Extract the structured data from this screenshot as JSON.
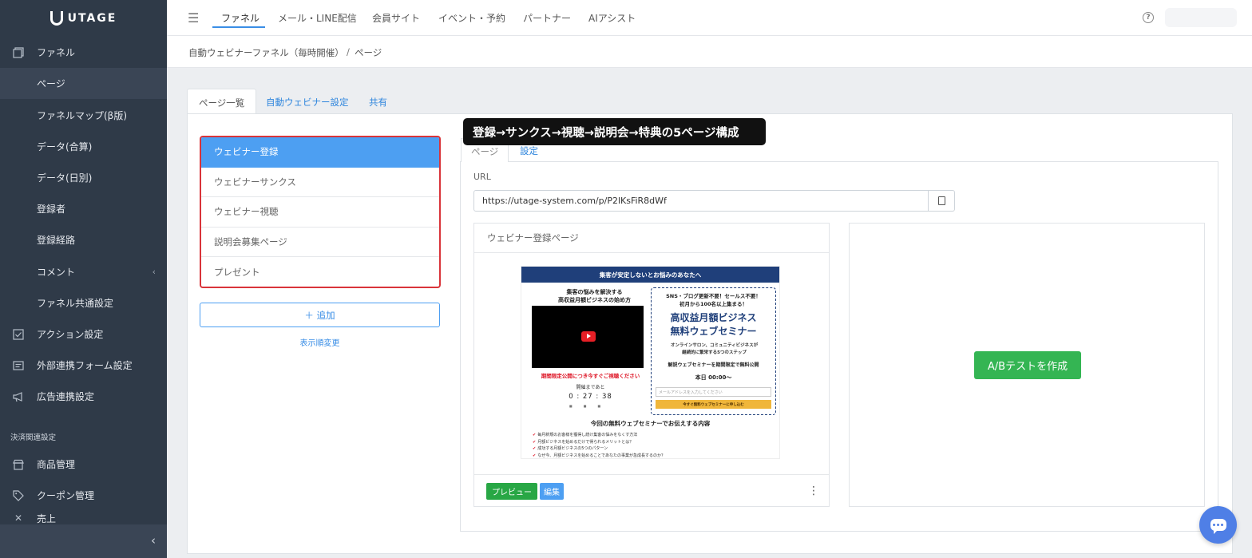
{
  "brand": {
    "name": "UTAGE"
  },
  "sidebar": {
    "items": [
      {
        "label": "ファネル",
        "icon": "funnel-icon"
      },
      {
        "label": "ページ"
      },
      {
        "label": "ファネルマップ(β版)"
      },
      {
        "label": "データ(合算)"
      },
      {
        "label": "データ(日別)"
      },
      {
        "label": "登録者"
      },
      {
        "label": "登録経路"
      },
      {
        "label": "コメント"
      },
      {
        "label": "ファネル共通設定"
      },
      {
        "label": "アクション設定",
        "icon": "checklist-icon"
      },
      {
        "label": "外部連携フォーム設定",
        "icon": "form-icon"
      },
      {
        "label": "広告連携設定",
        "icon": "megaphone-icon"
      },
      {
        "label": "商品管理",
        "icon": "store-icon"
      },
      {
        "label": "クーポン管理",
        "icon": "tag-icon"
      },
      {
        "label": "売上"
      }
    ],
    "section_label": "決済関連設定"
  },
  "topnav": {
    "items": [
      "ファネル",
      "メール・LINE配信",
      "会員サイト",
      "イベント・予約",
      "パートナー",
      "AIアシスト"
    ]
  },
  "breadcrumb": {
    "funnel": "自動ウェビナーファネル（毎時開催）",
    "separator": "/",
    "current": "ページ"
  },
  "tabs": [
    "ページ一覧",
    "自動ウェビナー設定",
    "共有"
  ],
  "pages": [
    "ウェビナー登録",
    "ウェビナーサンクス",
    "ウェビナー視聴",
    "説明会募集ページ",
    "プレゼント"
  ],
  "add_label": "＋ 追加",
  "reorder_label": "表示順変更",
  "annotation": "登録→サンクス→視聴→説明会→特典の5ページ構成",
  "detail": {
    "tabs": [
      "ページ",
      "設定"
    ],
    "url_label": "URL",
    "url_value": "https://utage-system.com/p/P2lKsFiR8dWf",
    "preview_title": "ウェビナー登録ページ",
    "preview_button": "プレビュー",
    "edit_button": "編集",
    "ab_button": "A/Bテストを作成"
  },
  "thumbnail": {
    "banner": "集客が安定しないとお悩みのあなたへ",
    "left_title_1": "集客の悩みを解決する",
    "left_title_2": "高収益月額ビジネスの始め方",
    "limited_notice": "期間限定公開につき今すぐご視聴ください",
    "until_label": "開催まであと",
    "countdown": "0 : 27 : 38",
    "box_line1": "SNS・ブログ更新不要！セールス不要！",
    "box_line2": "初月から100名以上集まる！",
    "box_heading1": "高収益月額ビジネス",
    "box_heading2": "無料ウェブセミナー",
    "box_desc1": "オンラインサロン、コミュニティビジネスが",
    "box_desc2": "継続的に繁栄する5つのステップ",
    "box_limited": "解説ウェブセミナーを期間限定で無料公開",
    "box_time": "本日 00:00〜",
    "email_placeholder": "メールアドレスを入力してください",
    "cta_label": "今すぐ無料ウェブセミナーに申し込む",
    "section_title": "今回の無料ウェブセミナーでお伝えする内容",
    "bullets": [
      "毎月新規のお客様を獲得し続け集客の悩みをなくす方法",
      "月額ビジネスを始めるだけで得られるメリットとは？",
      "成功する月額ビジネスの5つのパターン",
      "なぜ今、月額ビジネスを始めることであなたの事業が急成長するのか？"
    ]
  }
}
